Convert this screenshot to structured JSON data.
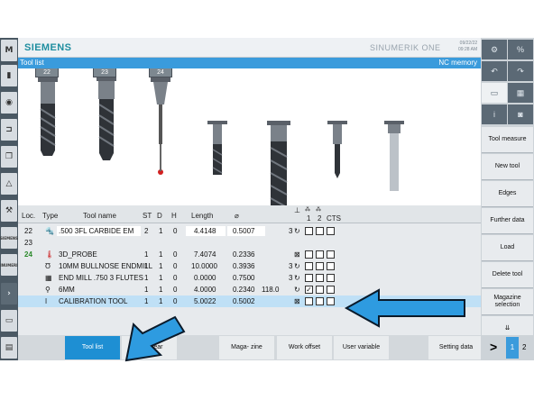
{
  "header": {
    "brand": "SIEMENS",
    "product": "SINUMERIK ONE",
    "date": "09/22/22",
    "time": "09:28 AM"
  },
  "title": {
    "left": "Tool list",
    "right": "NC memory"
  },
  "holders": [
    "22",
    "23",
    "24"
  ],
  "left_buttons": [
    "M",
    "",
    "",
    "",
    "",
    "",
    "",
    "SIEMENS",
    "SINUMERIK",
    "",
    "",
    ""
  ],
  "table": {
    "headers": {
      "loc": "Loc.",
      "type": "Type",
      "name": "Tool name",
      "st": "ST",
      "d": "D",
      "h": "H",
      "length": "Length",
      "diameter": "⌀",
      "col1": "1",
      "col2": "2",
      "cts": "CTS"
    },
    "rows": [
      {
        "loc": "22",
        "name": ".500 3FL CARBIDE EM",
        "st": "2",
        "d": "1",
        "h": "0",
        "length": "4.4148",
        "diameter": "0.5007",
        "extra": "",
        "n": "3"
      },
      {
        "loc": "23",
        "name": "",
        "st": "",
        "d": "",
        "h": "",
        "length": "",
        "diameter": "",
        "extra": "",
        "n": ""
      },
      {
        "loc": "24",
        "name": "3D_PROBE",
        "st": "1",
        "d": "1",
        "h": "0",
        "length": "7.4074",
        "diameter": "0.2336",
        "extra": "",
        "n": ""
      },
      {
        "loc": "",
        "name": "10MM BULLNOSE ENDMILL",
        "st": "1",
        "d": "1",
        "h": "0",
        "length": "10.0000",
        "diameter": "0.3936",
        "extra": "",
        "n": "3"
      },
      {
        "loc": "",
        "name": "END MILL .750 3 FLUTES",
        "st": "1",
        "d": "1",
        "h": "0",
        "length": "0.0000",
        "diameter": "0.7500",
        "extra": "",
        "n": "3"
      },
      {
        "loc": "",
        "name": "6MM",
        "st": "1",
        "d": "1",
        "h": "0",
        "length": "4.0000",
        "diameter": "0.2340",
        "extra": "118.0",
        "n": ""
      },
      {
        "loc": "",
        "name": "CALIBRATION TOOL",
        "st": "1",
        "d": "1",
        "h": "0",
        "length": "5.0022",
        "diameter": "0.5002",
        "extra": "",
        "n": ""
      }
    ]
  },
  "right_softkeys": [
    "Tool measure",
    "New tool",
    "Edges",
    "Further data",
    "Load",
    "Delete tool",
    "Magazine selection"
  ],
  "bottom_softkeys": [
    "Tool list",
    "Tool wear",
    "Maga- zine",
    "Work offset",
    "User variable",
    "Setting data"
  ],
  "bottom_right": {
    "next": ">",
    "page1": "1",
    "page2": "2"
  },
  "colors": {
    "accent": "#3a9bdc",
    "brand": "#1f8ea0",
    "arrow": "#2e9be0"
  }
}
